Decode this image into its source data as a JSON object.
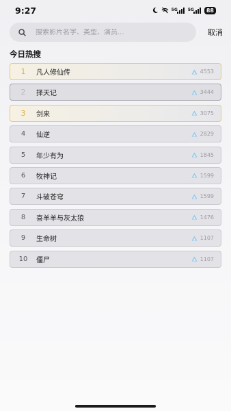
{
  "status_bar": {
    "time": "9:27",
    "network_1": "5G",
    "network_2": "5G",
    "battery": "88",
    "icons": [
      "moon-icon",
      "mute-icon",
      "signal-icon",
      "signal-icon",
      "battery-icon"
    ]
  },
  "search": {
    "placeholder": "搜索影片名字、类型、演员...",
    "value": "",
    "cancel_label": "取消"
  },
  "section": {
    "title": "今日热搜"
  },
  "colors": {
    "top_accent": "#e0b33f",
    "heat_icon": "#8fc6e8"
  },
  "hot_list": [
    {
      "rank": "1",
      "title": "凡人修仙传",
      "heat": "4553"
    },
    {
      "rank": "2",
      "title": "择天记",
      "heat": "3444"
    },
    {
      "rank": "3",
      "title": "剑来",
      "heat": "3075"
    },
    {
      "rank": "4",
      "title": "仙逆",
      "heat": "2829"
    },
    {
      "rank": "5",
      "title": "年少有为",
      "heat": "1845"
    },
    {
      "rank": "6",
      "title": "牧神记",
      "heat": "1599"
    },
    {
      "rank": "7",
      "title": "斗破苍穹",
      "heat": "1599"
    },
    {
      "rank": "8",
      "title": "喜羊羊与灰太狼",
      "heat": "1476"
    },
    {
      "rank": "9",
      "title": "生命树",
      "heat": "1107"
    },
    {
      "rank": "10",
      "title": "僵尸",
      "heat": "1107"
    }
  ]
}
